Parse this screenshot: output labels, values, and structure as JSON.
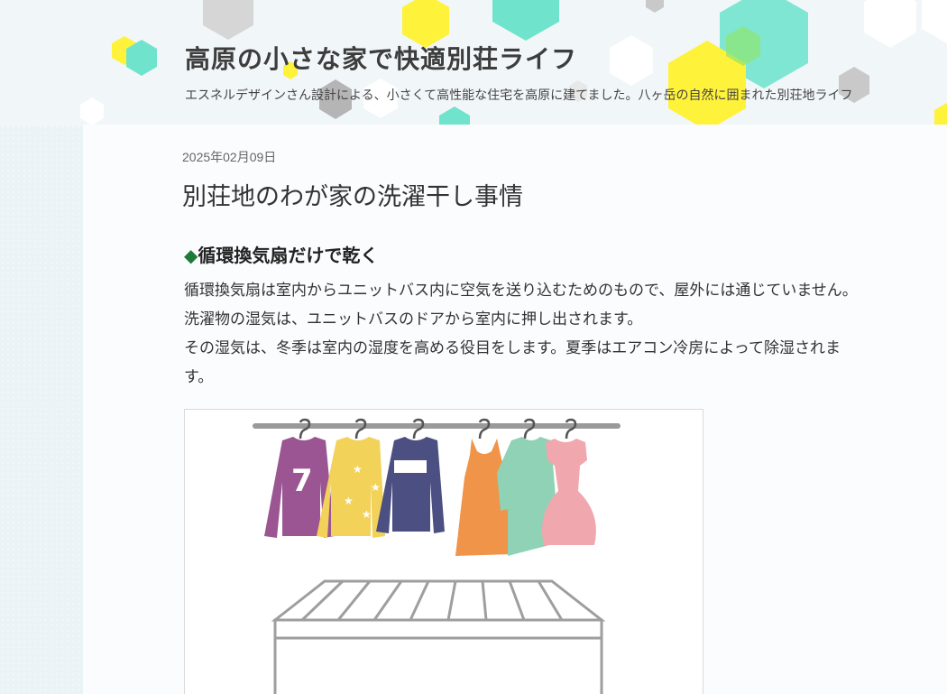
{
  "header": {
    "site_title": "高原の小さな家で快適別荘ライフ",
    "site_description": "エスネルデザインさん設計による、小さくて高性能な住宅を高原に建てました。八ヶ岳の自然に囲まれた別荘地ライフ"
  },
  "post": {
    "date": "2025年02月09日",
    "title": "別荘地のわが家の洗濯干し事情",
    "section_heading_mark": "◆",
    "section_heading": "循環換気扇だけで乾く",
    "paragraphs": [
      "循環換気扇は室内からユニットバス内に空気を送り込むためのもので、屋外には通じていません。洗濯物の湿気は、ユニットバスのドアから室内に押し出されます。",
      "その湿気は、冬季は室内の湿度を高める役目をします。夏季はエアコン冷房によって除湿されます。"
    ],
    "shirt_number": "7"
  },
  "colors": {
    "hex_yellow": "#fff23a",
    "hex_teal": "#6fe3cc",
    "hex_gray": "#c9c9c9",
    "heading_diamond": "#1f7a3a"
  },
  "icons": {
    "illustration": "laundry-hanging-illustration"
  }
}
